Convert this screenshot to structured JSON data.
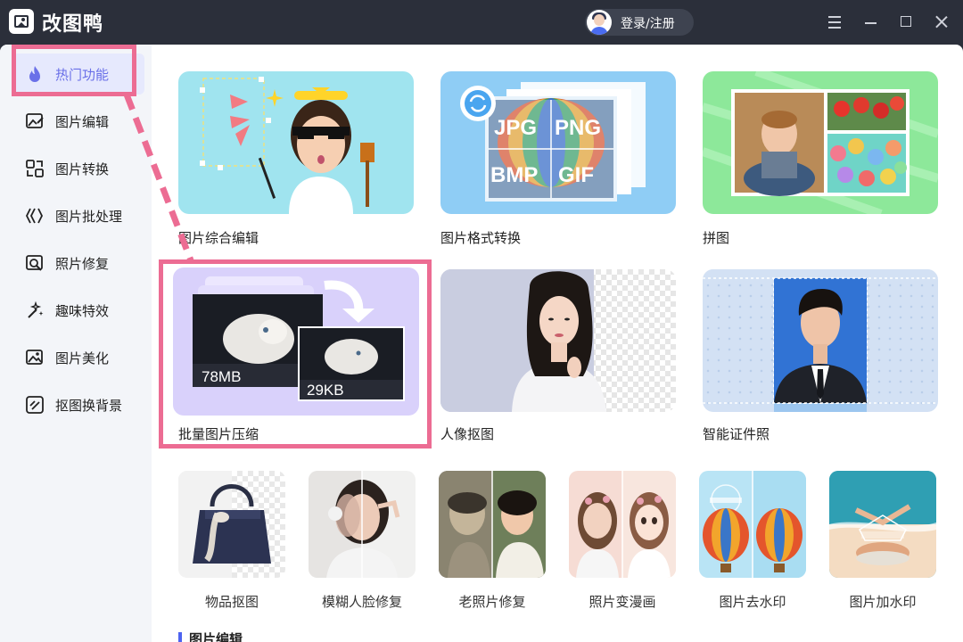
{
  "app": {
    "title": "改图鸭",
    "login_label": "登录/注册"
  },
  "sidebar": {
    "items": [
      {
        "label": "热门功能",
        "icon": "fire-icon",
        "active": true
      },
      {
        "label": "图片编辑",
        "icon": "image-edit-icon"
      },
      {
        "label": "图片转换",
        "icon": "convert-icon"
      },
      {
        "label": "图片批处理",
        "icon": "batch-icon"
      },
      {
        "label": "照片修复",
        "icon": "photo-repair-icon"
      },
      {
        "label": "趣味特效",
        "icon": "sparkle-wand-icon"
      },
      {
        "label": "图片美化",
        "icon": "beautify-icon"
      },
      {
        "label": "抠图换背景",
        "icon": "cutout-icon"
      }
    ]
  },
  "features_large": [
    {
      "label": "图片综合编辑"
    },
    {
      "label": "图片格式转换",
      "formats": [
        "JPG",
        "PNG",
        "BMP",
        "GIF"
      ]
    },
    {
      "label": "拼图"
    },
    {
      "label": "批量图片压缩",
      "size_before": "78MB",
      "size_after": "29KB"
    },
    {
      "label": "人像抠图"
    },
    {
      "label": "智能证件照"
    }
  ],
  "features_small": [
    {
      "label": "物品抠图"
    },
    {
      "label": "模糊人脸修复"
    },
    {
      "label": "老照片修复"
    },
    {
      "label": "照片变漫画"
    },
    {
      "label": "图片去水印"
    },
    {
      "label": "图片加水印"
    }
  ],
  "section": {
    "title": "图片编辑"
  },
  "colors": {
    "accent": "#6a70e8",
    "highlight": "#ec6c93",
    "titlebar": "#2b2f3a"
  }
}
